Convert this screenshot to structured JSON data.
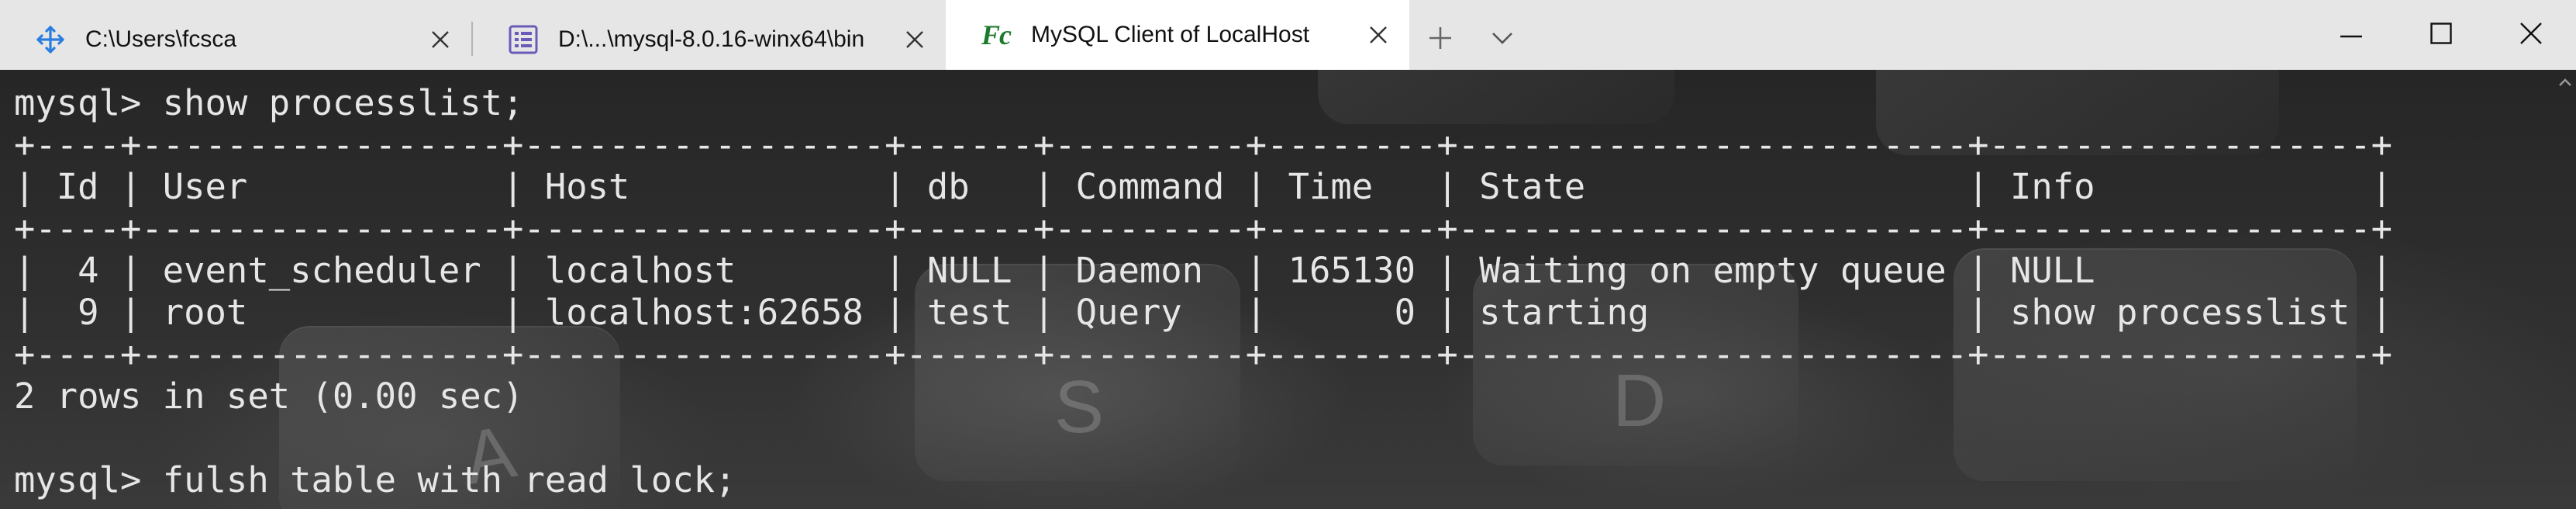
{
  "tabs": [
    {
      "label": "C:\\Users\\fcsca",
      "icon": "move-arrows-icon",
      "active": false
    },
    {
      "label": "D:\\...\\mysql-8.0.16-winx64\\bin",
      "icon": "list-app-icon",
      "active": false
    },
    {
      "label": "MySQL Client of LocalHost",
      "icon": "fc-logo-icon",
      "active": true
    }
  ],
  "tab_logo_text": "Fc",
  "console_lines": [
    "mysql> show processlist;",
    "+----+-----------------+-----------------+------+---------+--------+------------------------+------------------+",
    "| Id | User            | Host            | db   | Command | Time   | State                  | Info             |",
    "+----+-----------------+-----------------+------+---------+--------+------------------------+------------------+",
    "|  4 | event_scheduler | localhost       | NULL | Daemon  | 165130 | Waiting on empty queue | NULL             |",
    "|  9 | root            | localhost:62658 | test | Query   |      0 | starting               | show processlist |",
    "+----+-----------------+-----------------+------+---------+--------+------------------------+------------------+",
    "2 rows in set (0.00 sec)",
    "",
    "mysql> fulsh table with read lock;"
  ],
  "background_key_letters": [
    "S",
    "D",
    "A"
  ],
  "colors": {
    "tabbar_bg": "#e6e6e6",
    "active_tab_bg": "#ffffff",
    "terminal_text": "#e6e6e6",
    "logo_green": "#1c7a2c",
    "tab_icon_blue": "#2b7de1",
    "tab_icon_purple": "#6b5bb8"
  }
}
